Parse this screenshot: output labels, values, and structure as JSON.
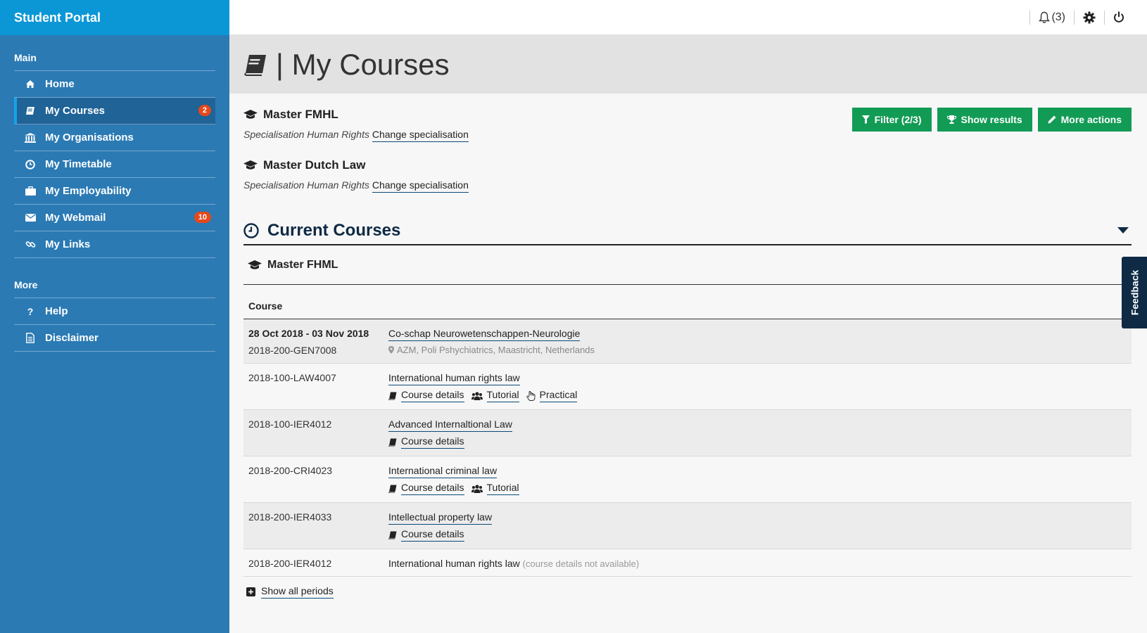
{
  "app": {
    "title": "Student Portal"
  },
  "sidebar": {
    "main_title": "Main",
    "main_items": [
      {
        "label": "Home",
        "icon": "home-icon"
      },
      {
        "label": "My Courses",
        "icon": "book-icon",
        "badge": "2",
        "active": true
      },
      {
        "label": "My Organisations",
        "icon": "institution-icon"
      },
      {
        "label": "My Timetable",
        "icon": "clock-icon"
      },
      {
        "label": "My Employability",
        "icon": "briefcase-icon"
      },
      {
        "label": "My Webmail",
        "icon": "envelope-icon",
        "badge": "10"
      },
      {
        "label": "My Links",
        "icon": "link-icon"
      }
    ],
    "more_title": "More",
    "more_items": [
      {
        "label": "Help",
        "icon": "question-icon"
      },
      {
        "label": "Disclaimer",
        "icon": "document-icon"
      }
    ]
  },
  "topbar": {
    "notifications_count": "(3)"
  },
  "page": {
    "title": "| My Courses"
  },
  "programs": [
    {
      "name": "Master FMHL",
      "specialisation": "Specialisation Human Rights",
      "change_label": "Change specialisation"
    },
    {
      "name": "Master Dutch Law",
      "specialisation": "Specialisation Human Rights",
      "change_label": "Change specialisation"
    }
  ],
  "actions": {
    "filter": "Filter (2/3)",
    "results": "Show results",
    "more": "More actions"
  },
  "current": {
    "title": "Current Courses",
    "program": "Master FHML",
    "column_header": "Course",
    "rows": [
      {
        "date": "28 Oct 2018 - 03 Nov 2018",
        "code": "2018-200-GEN7008",
        "title": "Co-schap Neurowetenschappen-Neurologie",
        "location": "AZM, Poli Pshychiatrics, Maastricht, Netherlands"
      },
      {
        "code": "2018-100-LAW4007",
        "title": "International human rights law",
        "links": [
          "Course details",
          "Tutorial",
          "Practical"
        ]
      },
      {
        "code": "2018-100-IER4012",
        "title": "Advanced Internaltional Law",
        "links": [
          "Course details"
        ]
      },
      {
        "code": "2018-200-CRI4023",
        "title": "International criminal law",
        "links": [
          "Course details",
          "Tutorial"
        ]
      },
      {
        "code": "2018-200-IER4033",
        "title": "Intellectual property law",
        "links": [
          "Course details"
        ]
      },
      {
        "code": "2018-200-IER4012",
        "title": "International human rights law",
        "note": "(course details not available)"
      }
    ],
    "show_all": "Show all periods"
  },
  "feedback": {
    "label": "Feedback"
  },
  "colors": {
    "sidebar": "#2b7ab4",
    "brand": "#0b97d6",
    "button": "#129b55",
    "badge": "#e5481b",
    "heading": "#0e2a45"
  }
}
